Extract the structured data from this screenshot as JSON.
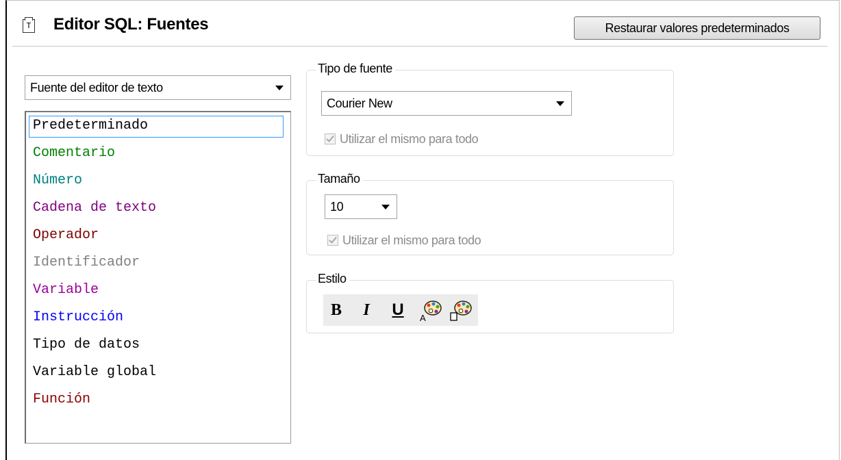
{
  "header": {
    "title": "Editor SQL: Fuentes",
    "restore_label": "Restaurar valores predeterminados"
  },
  "font_target": {
    "selected": "Fuente del editor de texto"
  },
  "list_items": [
    {
      "label": "Predeterminado",
      "color": "#000000"
    },
    {
      "label": "Comentario",
      "color": "#008000"
    },
    {
      "label": "Número",
      "color": "#008080"
    },
    {
      "label": "Cadena de texto",
      "color": "#800080"
    },
    {
      "label": "Operador",
      "color": "#800000"
    },
    {
      "label": "Identificador",
      "color": "#808080"
    },
    {
      "label": "Variable",
      "color": "#990099"
    },
    {
      "label": "Instrucción",
      "color": "#0000ff"
    },
    {
      "label": "Tipo de datos",
      "color": "#000000"
    },
    {
      "label": "Variable global",
      "color": "#000000"
    },
    {
      "label": "Función",
      "color": "#8b0000"
    }
  ],
  "font_type": {
    "legend": "Tipo de fuente",
    "selected": "Courier New",
    "same_for_all": "Utilizar el mismo para todo"
  },
  "size": {
    "legend": "Tamaño",
    "selected": "10",
    "same_for_all": "Utilizar el mismo para todo"
  },
  "style": {
    "legend": "Estilo",
    "bold": "B",
    "italic": "I",
    "underline": "U",
    "icons": [
      "text-color-icon",
      "background-color-icon"
    ]
  }
}
